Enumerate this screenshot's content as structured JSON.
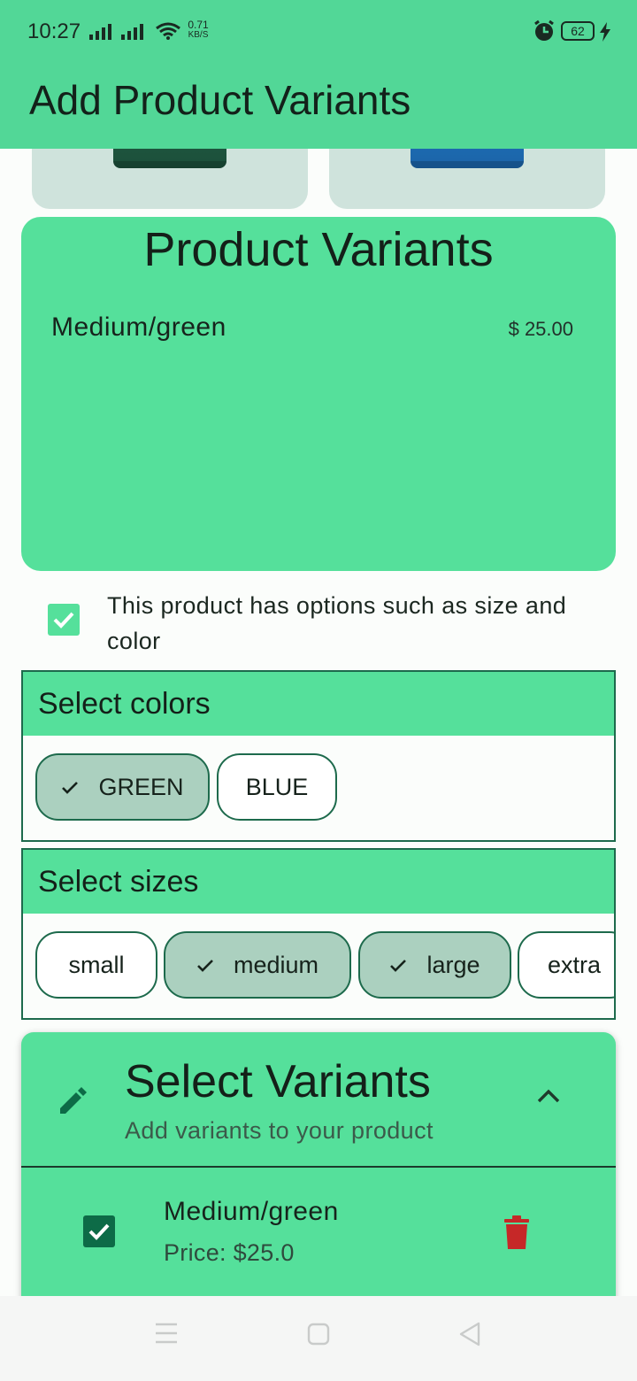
{
  "status_bar": {
    "time": "10:27",
    "net_speed_value": "0.71",
    "net_speed_unit": "KB/S",
    "battery": "62",
    "icons": [
      "signal-icon",
      "signal-icon",
      "wifi-icon",
      "alarm-icon",
      "battery-icon",
      "charging-icon"
    ]
  },
  "app_bar": {
    "title": "Add Product Variants"
  },
  "product_images": [
    {
      "color": "green",
      "swatch": "#1f5a42"
    },
    {
      "color": "blue",
      "swatch": "#1f70b8"
    }
  ],
  "product_variants_card": {
    "title": "Product Variants",
    "items": [
      {
        "name": "Medium/green",
        "price": "$ 25.00"
      }
    ]
  },
  "options_checkbox": {
    "checked": true,
    "label": "This product has options such as size and color"
  },
  "select_colors": {
    "header": "Select colors",
    "chips": [
      {
        "label": "GREEN",
        "selected": true
      },
      {
        "label": "BLUE",
        "selected": false
      }
    ]
  },
  "select_sizes": {
    "header": "Select sizes",
    "chips": [
      {
        "label": "small",
        "selected": false
      },
      {
        "label": "medium",
        "selected": true
      },
      {
        "label": "large",
        "selected": true
      },
      {
        "label": "extra",
        "selected": false
      }
    ]
  },
  "select_variants": {
    "title": "Select Variants",
    "subtitle": "Add variants to your product",
    "expanded": true,
    "items": [
      {
        "name": "Medium/green",
        "price": "Price: $25.0",
        "checked": true
      }
    ]
  },
  "colors": {
    "primary": "#52d797",
    "card": "#55e09b",
    "chip_border": "#1d6a4c",
    "chip_selected": "#abd0bf",
    "delete": "#c62828"
  }
}
